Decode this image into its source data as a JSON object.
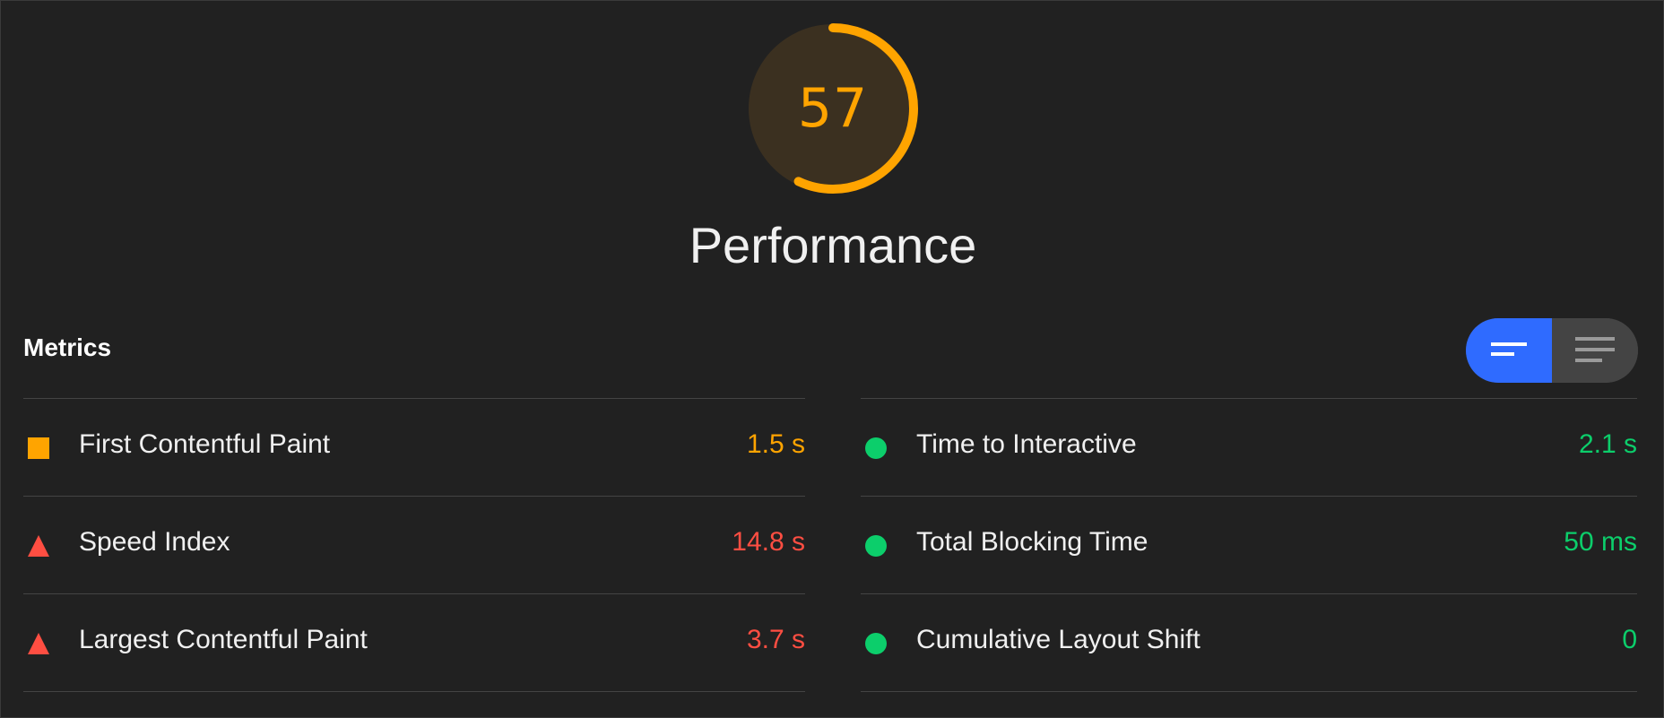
{
  "score": {
    "value": 57,
    "fraction": 0.57,
    "title": "Performance",
    "color": "#ffa400",
    "background": "#3b3020"
  },
  "metrics": {
    "heading": "Metrics",
    "toggle": {
      "options": [
        {
          "name": "summary-view",
          "icon": "summary-lines-icon",
          "active": true
        },
        {
          "name": "expanded-view",
          "icon": "list-lines-icon",
          "active": false
        }
      ],
      "active_color": "#2f6bff"
    },
    "left": [
      {
        "label": "First Contentful Paint",
        "value": "1.5 s",
        "rating": "average",
        "shape": "square",
        "color": "#ffa400"
      },
      {
        "label": "Speed Index",
        "value": "14.8 s",
        "rating": "fail",
        "shape": "triangle",
        "color": "#ff4e42"
      },
      {
        "label": "Largest Contentful Paint",
        "value": "3.7 s",
        "rating": "fail",
        "shape": "triangle",
        "color": "#ff4e42"
      }
    ],
    "right": [
      {
        "label": "Time to Interactive",
        "value": "2.1 s",
        "rating": "pass",
        "shape": "circle",
        "color": "#0cce6b"
      },
      {
        "label": "Total Blocking Time",
        "value": "50 ms",
        "rating": "pass",
        "shape": "circle",
        "color": "#0cce6b"
      },
      {
        "label": "Cumulative Layout Shift",
        "value": "0",
        "rating": "pass",
        "shape": "circle",
        "color": "#0cce6b"
      }
    ]
  }
}
